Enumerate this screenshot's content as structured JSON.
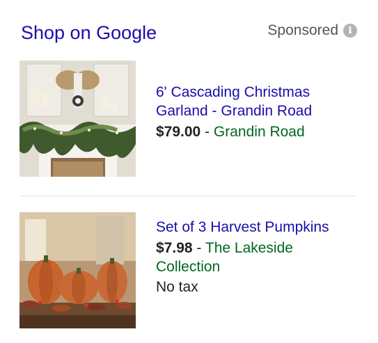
{
  "header": {
    "title": "Shop on Google",
    "sponsored_label": "Sponsored",
    "info_icon_glyph": "i"
  },
  "items": [
    {
      "title": "6' Cascading Christmas Garland - Grandin Road",
      "price": "$79.00",
      "separator": "-",
      "merchant": "Grandin Road",
      "extra": "",
      "image": "christmas-garland-mantel-icon"
    },
    {
      "title": "Set of 3 Harvest Pumpkins",
      "price": "$7.98",
      "separator": "-",
      "merchant": "The Lakeside Collection",
      "extra": "No tax",
      "image": "harvest-pumpkins-icon"
    }
  ],
  "colors": {
    "link": "#1a0dab",
    "merchant": "#006621",
    "text": "#222222",
    "muted": "#545454"
  }
}
